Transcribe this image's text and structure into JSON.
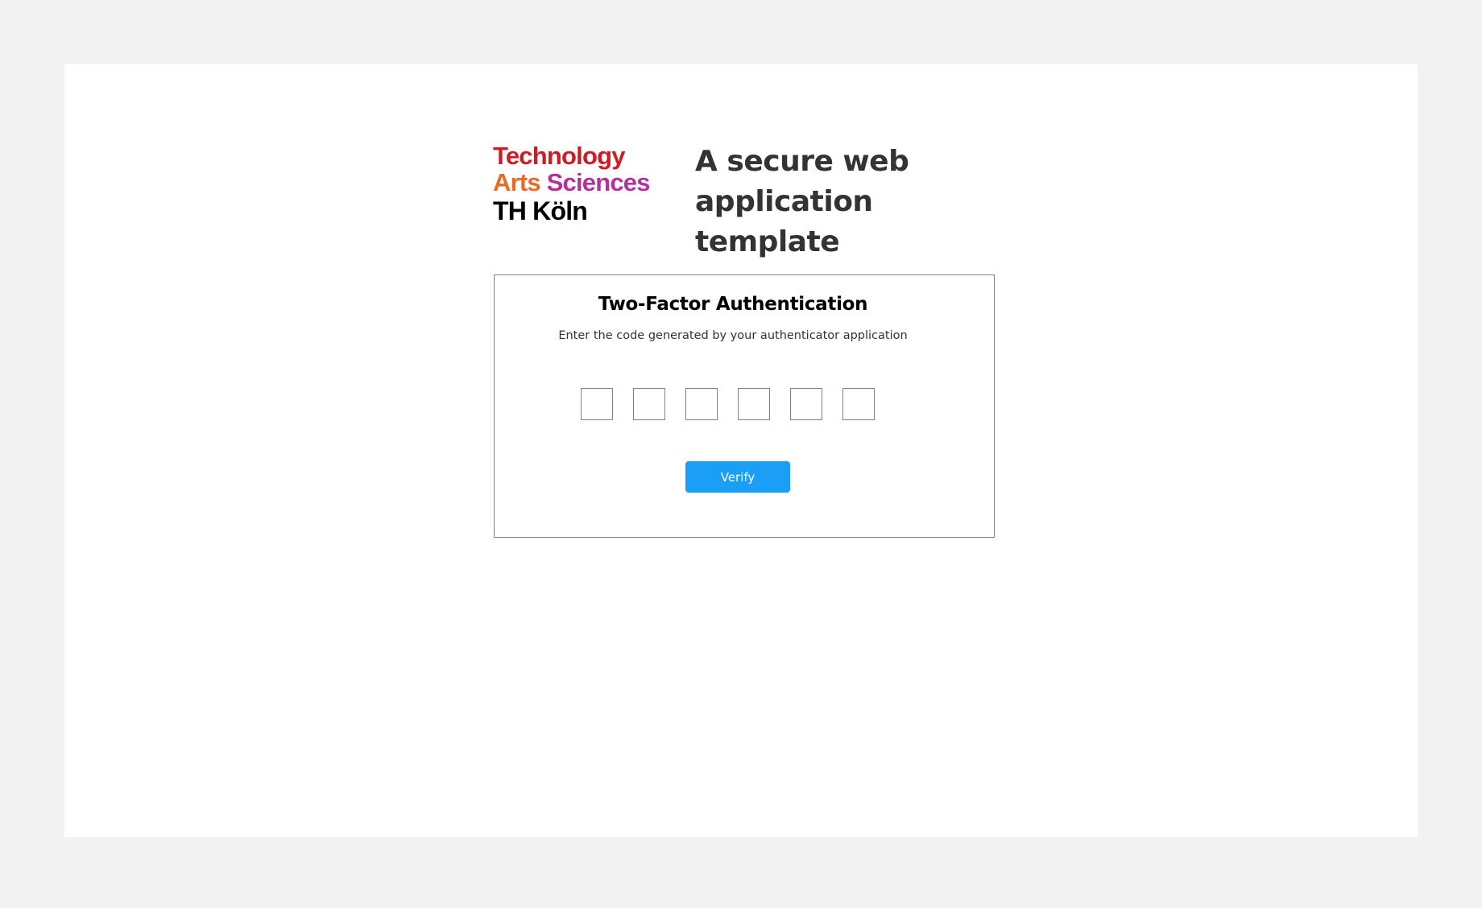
{
  "logo": {
    "line1": "Technology",
    "line2_word1": "Arts",
    "line2_word2": "Sciences",
    "line3": "TH Köln",
    "colors": {
      "technology": "#cf1b24",
      "arts": "#ea6a25",
      "sciences": "#b4309a",
      "th_koeln": "#000000"
    }
  },
  "header": {
    "tagline": "A secure web application template"
  },
  "auth": {
    "title": "Two-Factor Authentication",
    "subtitle": "Enter the code generated by your authenticator application",
    "code_digits": [
      "",
      "",
      "",
      "",
      "",
      ""
    ],
    "verify_label": "Verify"
  },
  "colors": {
    "page_background": "#f2f2f2",
    "card_background": "#ffffff",
    "accent": "#1a9ef6",
    "border": "#808080",
    "heading_text": "#333333"
  }
}
